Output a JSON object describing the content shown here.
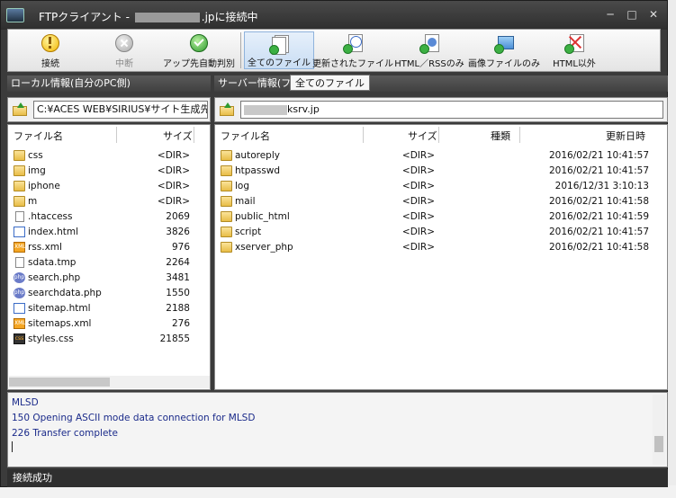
{
  "window": {
    "title_prefix": "FTPクライアント - ",
    "title_suffix": ".jpに接続中",
    "controls": {
      "minimize": "─",
      "maximize": "□",
      "close": "✕"
    }
  },
  "toolbar": {
    "connect": "接続",
    "disconnect": "中断",
    "upload_auto": "アップ先自動判別",
    "all_files": "全てのファイル",
    "updated_files": "更新されたファイル",
    "html_rss": "HTML／RSSのみ",
    "images_only": "画像ファイルのみ",
    "non_html": "HTML以外"
  },
  "tooltip": "全てのファイル",
  "local": {
    "header": "ローカル情報(自分のPC側)",
    "path": "C:¥ACES WEB¥SIRIUS¥サイト生成先¥]",
    "col_name": "ファイル名",
    "col_size": "サイズ",
    "files": [
      {
        "icon": "folder",
        "name": "css",
        "size": "<DIR>"
      },
      {
        "icon": "folder",
        "name": "img",
        "size": "<DIR>"
      },
      {
        "icon": "folder",
        "name": "iphone",
        "size": "<DIR>"
      },
      {
        "icon": "folder",
        "name": "m",
        "size": "<DIR>"
      },
      {
        "icon": "file",
        "name": ".htaccess",
        "size": "2069"
      },
      {
        "icon": "html",
        "name": "index.html",
        "size": "3826"
      },
      {
        "icon": "xml",
        "name": "rss.xml",
        "size": "976"
      },
      {
        "icon": "file",
        "name": "sdata.tmp",
        "size": "2264"
      },
      {
        "icon": "php",
        "name": "search.php",
        "size": "3481"
      },
      {
        "icon": "php",
        "name": "searchdata.php",
        "size": "1550"
      },
      {
        "icon": "html",
        "name": "sitemap.html",
        "size": "2188"
      },
      {
        "icon": "xml",
        "name": "sitemaps.xml",
        "size": "276"
      },
      {
        "icon": "css",
        "name": "styles.css",
        "size": "21855"
      }
    ]
  },
  "server": {
    "header": "サーバー情報(フ",
    "path_suffix": "ksrv.jp",
    "col_name": "ファイル名",
    "col_size": "サイズ",
    "col_type": "種類",
    "col_date": "更新日時",
    "files": [
      {
        "name": "autoreply",
        "size": "<DIR>",
        "date": "2016/02/21 10:41:57"
      },
      {
        "name": "htpasswd",
        "size": "<DIR>",
        "date": "2016/02/21 10:41:57"
      },
      {
        "name": "log",
        "size": "<DIR>",
        "date": "2016/12/31 3:10:13"
      },
      {
        "name": "mail",
        "size": "<DIR>",
        "date": "2016/02/21 10:41:58"
      },
      {
        "name": "public_html",
        "size": "<DIR>",
        "date": "2016/02/21 10:41:59"
      },
      {
        "name": "script",
        "size": "<DIR>",
        "date": "2016/02/21 10:41:57"
      },
      {
        "name": "xserver_php",
        "size": "<DIR>",
        "date": "2016/02/21 10:41:58"
      }
    ]
  },
  "log": {
    "lines": [
      "MLSD",
      "150 Opening ASCII mode data connection for MLSD",
      "226 Transfer complete"
    ]
  },
  "status": "接続成功"
}
